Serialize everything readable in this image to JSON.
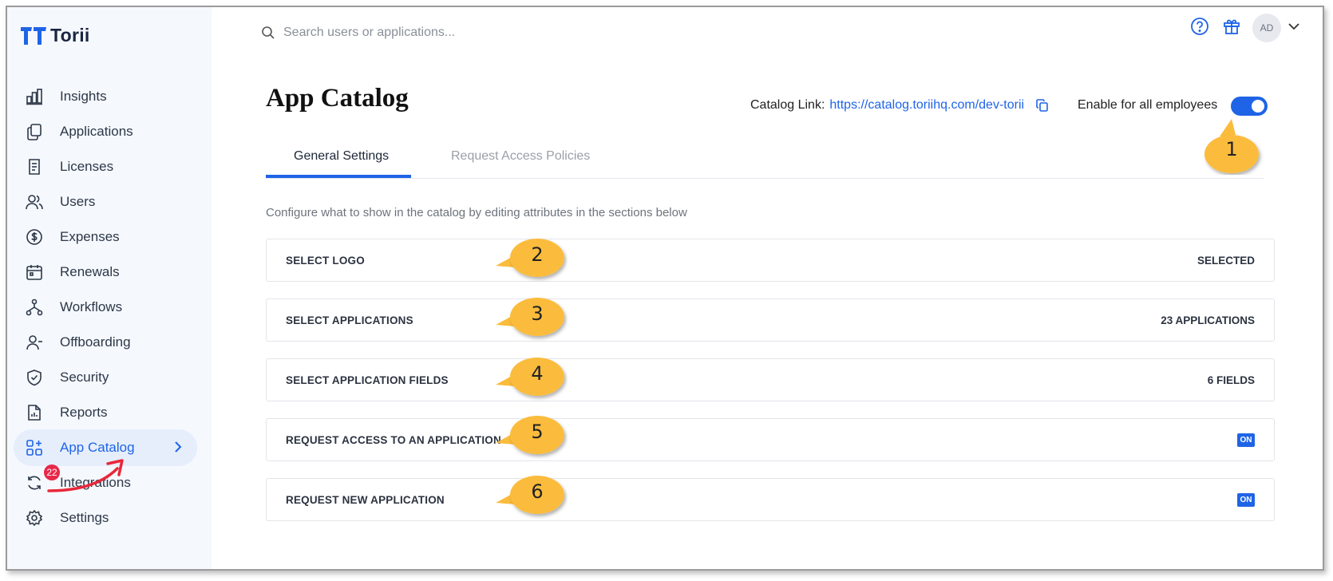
{
  "app": {
    "logo_text": "Torii"
  },
  "search": {
    "placeholder": "Search users or applications..."
  },
  "header": {
    "avatar_initials": "AD"
  },
  "sidebar": {
    "items": [
      {
        "label": "Insights",
        "icon": "chart-bars-icon"
      },
      {
        "label": "Applications",
        "icon": "copy-stack-icon"
      },
      {
        "label": "Licenses",
        "icon": "document-icon"
      },
      {
        "label": "Users",
        "icon": "users-icon"
      },
      {
        "label": "Expenses",
        "icon": "dollar-circle-icon"
      },
      {
        "label": "Renewals",
        "icon": "calendar-icon"
      },
      {
        "label": "Workflows",
        "icon": "workflow-icon"
      },
      {
        "label": "Offboarding",
        "icon": "user-minus-icon"
      },
      {
        "label": "Security",
        "icon": "shield-check-icon"
      },
      {
        "label": "Reports",
        "icon": "report-icon"
      },
      {
        "label": "App Catalog",
        "icon": "grid-plus-icon",
        "active": true
      },
      {
        "label": "Integrations",
        "icon": "sync-icon",
        "badge": "22"
      },
      {
        "label": "Settings",
        "icon": "gear-icon"
      }
    ]
  },
  "page": {
    "title": "App Catalog",
    "catalog_link_label": "Catalog Link:",
    "catalog_link_url": "https://catalog.toriihq.com/dev-torii",
    "enable_label": "Enable for all employees",
    "enable_on": true,
    "tabs": [
      {
        "label": "General Settings",
        "active": true
      },
      {
        "label": "Request Access Policies",
        "active": false
      }
    ],
    "description": "Configure what to show in the catalog by editing attributes in the sections below",
    "sections": [
      {
        "label": "SELECT LOGO",
        "value": "SELECTED"
      },
      {
        "label": "SELECT APPLICATIONS",
        "value": "23 APPLICATIONS"
      },
      {
        "label": "SELECT APPLICATION FIELDS",
        "value": "6 FIELDS"
      },
      {
        "label": "REQUEST ACCESS TO AN APPLICATION",
        "value": "ON"
      },
      {
        "label": "REQUEST NEW APPLICATION",
        "value": "ON"
      }
    ]
  },
  "callouts": [
    "1",
    "2",
    "3",
    "4",
    "5",
    "6"
  ],
  "colors": {
    "accent": "#1f64e6",
    "callout": "#fbbc3c",
    "badge": "#e8284a",
    "arrow": "#e8283a"
  }
}
